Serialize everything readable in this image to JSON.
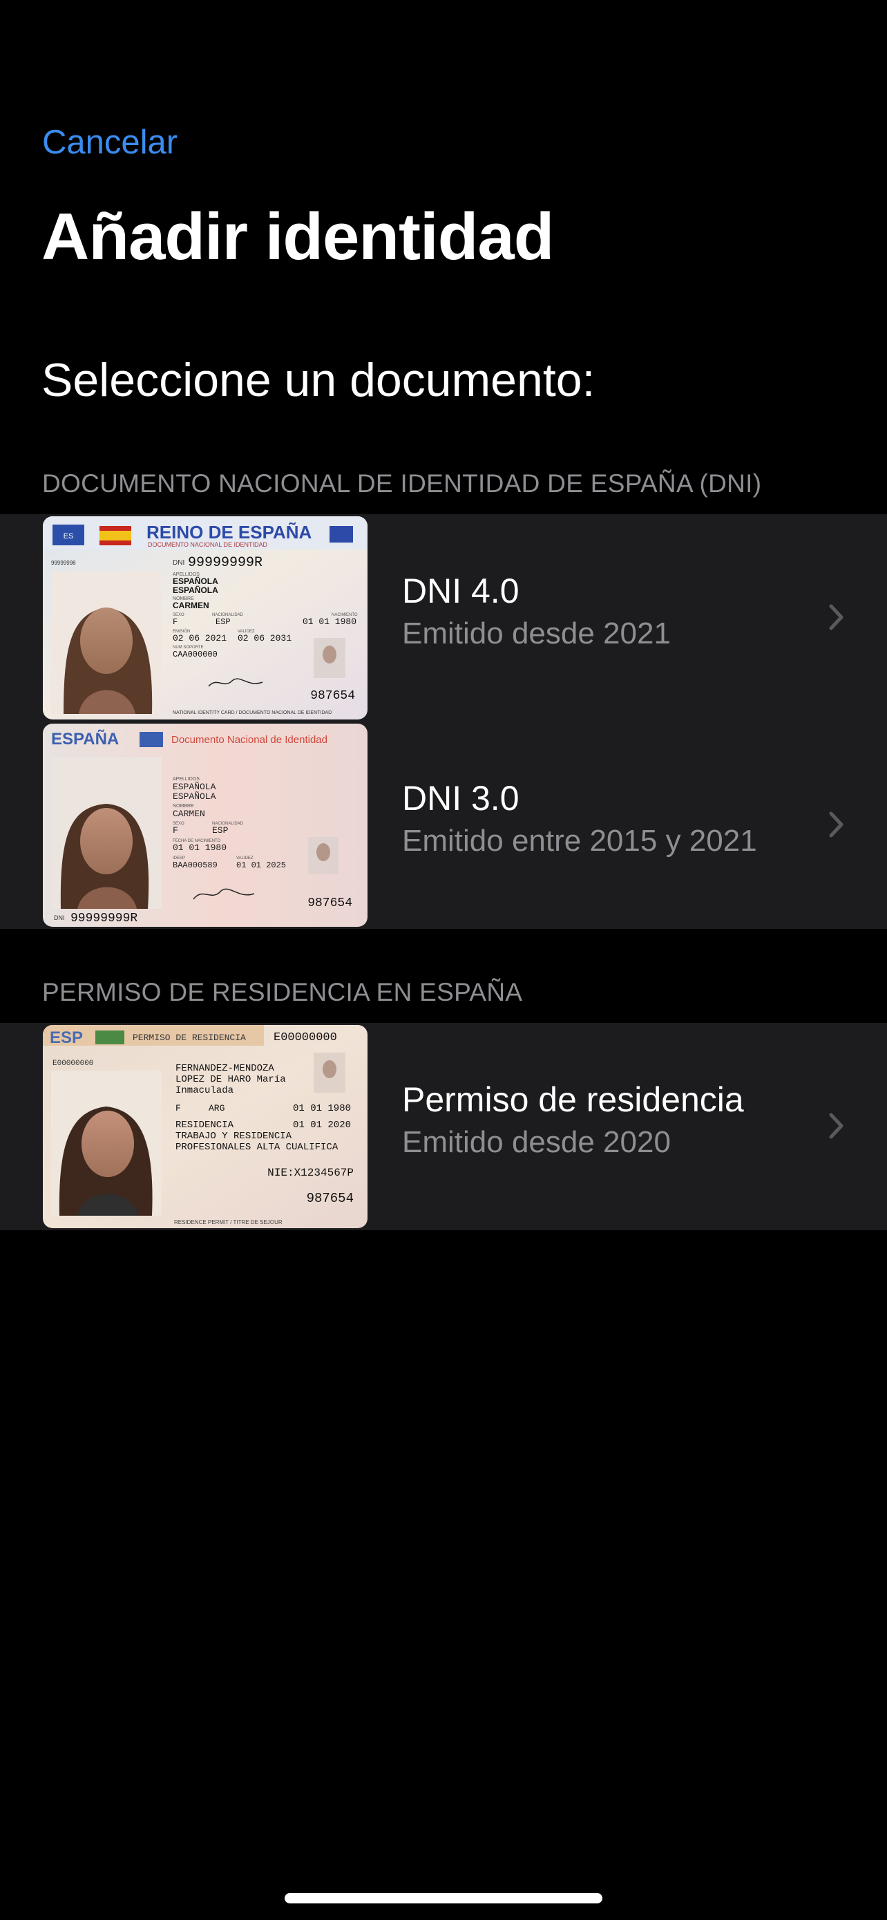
{
  "nav": {
    "cancel_label": "Cancelar"
  },
  "page": {
    "title": "Añadir identidad",
    "subtitle": "Seleccione un documento:"
  },
  "colors": {
    "accent": "#3b8cf0",
    "background": "#000000",
    "cell_background": "#1c1c1e",
    "secondary_text": "#8e8e93"
  },
  "sections": [
    {
      "header": "DOCUMENTO NACIONAL DE IDENTIDAD DE ESPAÑA (DNI)",
      "items": [
        {
          "title": "DNI 4.0",
          "subtitle": "Emitido desde 2021",
          "card": {
            "country": "REINO DE ESPAÑA",
            "doc_title": "DOCUMENTO NACIONAL DE IDENTIDAD",
            "small_id": "99999998",
            "dni_label": "DNI",
            "dni_number": "99999999R",
            "apellidos_label": "APELLIDOS",
            "surname1": "ESPAÑOLA",
            "surname2": "ESPAÑOLA",
            "nombre_label": "NOMBRE",
            "name": "CARMEN",
            "sexo_label": "SEXO",
            "sex": "F",
            "nacionalidad_label": "NACIONALIDAD",
            "nationality": "ESP",
            "nacimiento_label": "NACIMIENTO",
            "birth": "01 01 1980",
            "emision_label": "EMISIÓN",
            "issue": "02 06 2021",
            "validez_label": "VALIDEZ",
            "expiry": "02 06 2031",
            "soporte_label": "NUM SOPORTE",
            "support": "CAA000000",
            "can": "987654",
            "footer": "NATIONAL IDENTITY CARD / DOCUMENTO NACIONAL DE IDENTIDAD",
            "eu_code": "ES"
          }
        },
        {
          "title": "DNI 3.0",
          "subtitle": "Emitido entre 2015 y 2021",
          "card": {
            "country": "ESPAÑA",
            "doc_title": "Documento Nacional de Identidad",
            "apellidos_label": "APELLIDOS",
            "surname1": "ESPAÑOLA",
            "surname2": "ESPAÑOLA",
            "nombre_label": "NOMBRE",
            "name": "CARMEN",
            "sexo_label": "SEXO",
            "sex": "F",
            "nacionalidad_label": "NACIONALIDAD",
            "nationality": "ESP",
            "nacimiento_label": "FECHA DE NACIMIENTO",
            "birth": "01 01 1980",
            "soporte_label": "IDESP",
            "support": "BAA000589",
            "validez_label": "VALIDEZ",
            "expiry": "01 01 2025",
            "dni_label": "DNI",
            "dni_number": "99999999R",
            "can": "987654"
          }
        }
      ]
    },
    {
      "header": "PERMISO DE RESIDENCIA EN ESPAÑA",
      "items": [
        {
          "title": "Permiso de residencia",
          "subtitle": "Emitido desde 2020",
          "card": {
            "country": "ESP",
            "doc_title": "PERMISO DE RESIDENCIA",
            "number_top": "E00000000",
            "number_left": "E00000000",
            "surname1": "FERNANDEZ-MENDOZA",
            "surname2": "LOPEZ DE HARO María",
            "name": "Inmaculada",
            "sex": "F",
            "nationality": "ARG",
            "birth": "01 01 1980",
            "permit_type": "RESIDENCIA",
            "permit_date": "01 01 2020",
            "remark1": "TRABAJO Y RESIDENCIA",
            "remark2": "PROFESIONALES ALTA CUALIFICA",
            "nie": "NIE:X1234567P",
            "can": "987654",
            "footer": "RESIDENCE PERMIT / TITRE DE SEJOUR"
          }
        }
      ]
    }
  ]
}
